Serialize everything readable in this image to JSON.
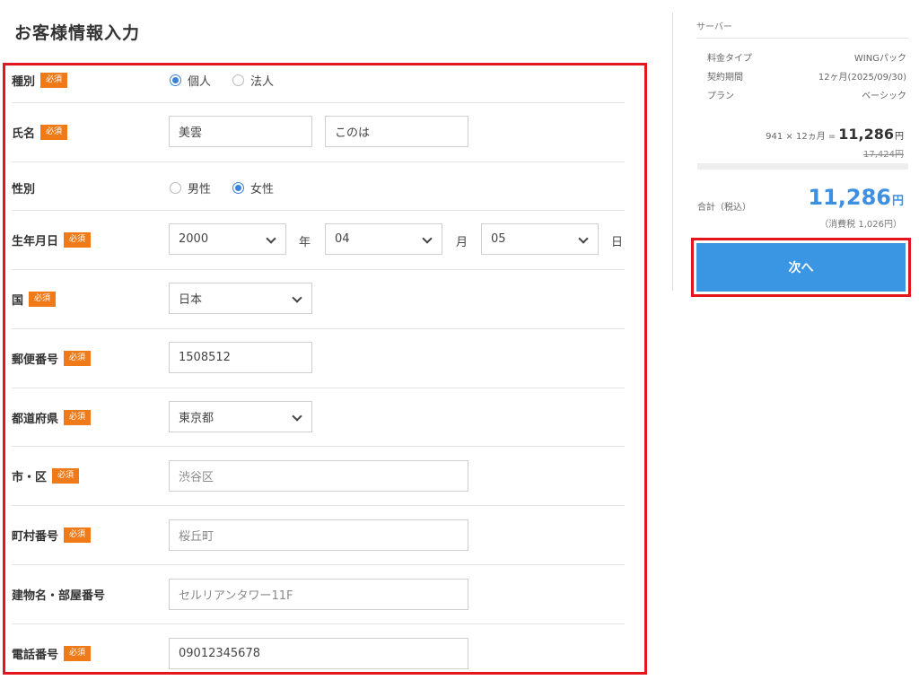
{
  "title": "お客様情報入力",
  "required_badge": "必須",
  "form": {
    "type": {
      "label": "種別",
      "options": [
        "個人",
        "法人"
      ],
      "selected": "個人"
    },
    "name": {
      "label": "氏名",
      "last": "美雲",
      "first": "このは"
    },
    "gender": {
      "label": "性別",
      "options": [
        "男性",
        "女性"
      ],
      "selected": "女性"
    },
    "birthdate": {
      "label": "生年月日",
      "year": "2000",
      "year_unit": "年",
      "month": "04",
      "month_unit": "月",
      "day": "05",
      "day_unit": "日"
    },
    "country": {
      "label": "国",
      "value": "日本"
    },
    "postal": {
      "label": "郵便番号",
      "value": "1508512"
    },
    "prefecture": {
      "label": "都道府県",
      "value": "東京都"
    },
    "city": {
      "label": "市・区",
      "value": "渋谷区"
    },
    "town": {
      "label": "町村番号",
      "value": "桜丘町"
    },
    "building": {
      "label": "建物名・部屋番号",
      "placeholder": "セルリアンタワー11F"
    },
    "phone": {
      "label": "電話番号",
      "value": "09012345678"
    }
  },
  "summary": {
    "title": "サーバー",
    "rows": [
      {
        "key": "料金タイプ",
        "value": "WINGパック"
      },
      {
        "key": "契約期間",
        "value": "12ヶ月(2025/09/30)"
      },
      {
        "key": "プラン",
        "value": "ベーシック"
      }
    ],
    "calc_prefix": "941 × 12ヵ月 =",
    "calc_price": "11,286",
    "yen": "円",
    "original_price": "17,424円",
    "total_label": "合計（税込）",
    "total_amount": "11,286",
    "tax_note": "（消費税 1,026円）"
  },
  "next_button": "次へ",
  "colors": {
    "accent": "#3a96e3",
    "badge": "#f07a18",
    "highlight": "#e3161d"
  }
}
